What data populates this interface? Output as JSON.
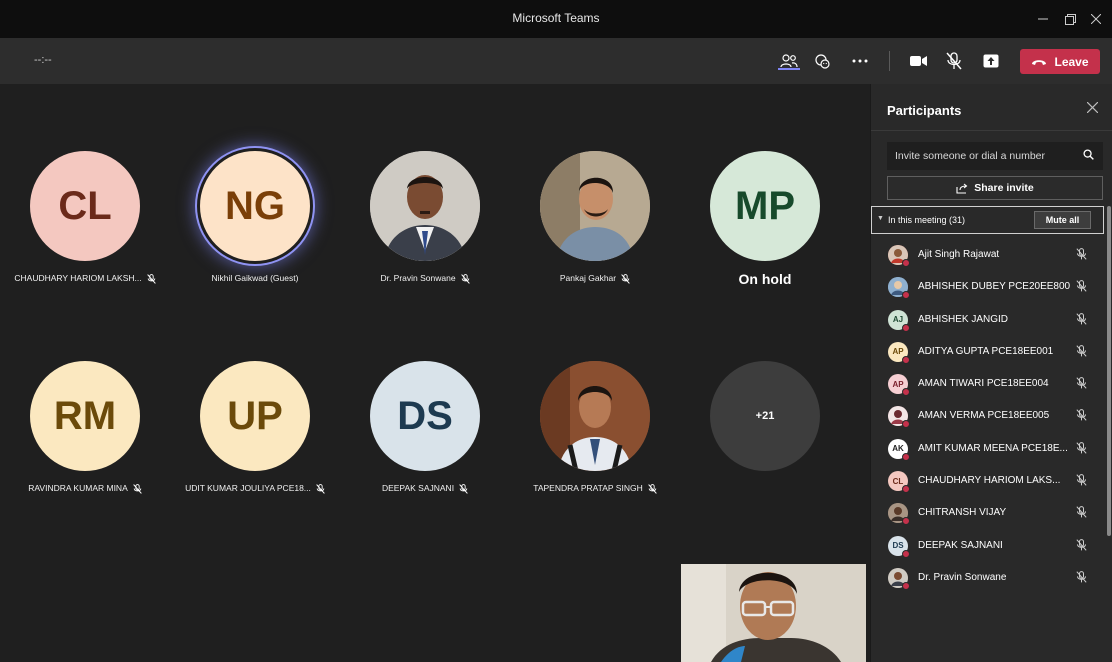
{
  "window": {
    "title": "Microsoft Teams"
  },
  "toolbar": {
    "timer": "--:--",
    "leave_label": "Leave"
  },
  "tiles": [
    {
      "initials": "CL",
      "name": "CHAUDHARY HARIOM LAKSH...",
      "bg": "#f4c8c0",
      "fg": "#6b2a1a",
      "muted": true
    },
    {
      "initials": "NG",
      "name": "Nikhil Gaikwad (Guest)",
      "bg": "#fde3c8",
      "fg": "#6b3a0a",
      "muted": false,
      "speaking": true
    },
    {
      "initials": "",
      "name": "Dr. Pravin Sonwane",
      "photo": true,
      "muted": true
    },
    {
      "initials": "",
      "name": "Pankaj Gakhar",
      "photo": true,
      "muted": true
    },
    {
      "initials": "MP",
      "name": "On hold",
      "bg": "#d6e8d8",
      "fg": "#174a2b",
      "muted": false,
      "onhold": true
    },
    {
      "initials": "RM",
      "name": "RAVINDRA KUMAR MINA",
      "bg": "#fbe8c0",
      "fg": "#6b4a0a",
      "muted": true
    },
    {
      "initials": "UP",
      "name": "UDIT KUMAR JOULIYA PCE18...",
      "bg": "#fbe8c0",
      "fg": "#6b4a0a",
      "muted": true
    },
    {
      "initials": "DS",
      "name": "DEEPAK SAJNANI",
      "bg": "#d9e3ea",
      "fg": "#1d3a50",
      "muted": true
    },
    {
      "initials": "",
      "name": "TAPENDRA PRATAP SINGH",
      "photo": true,
      "muted": true
    },
    {
      "initials": "+21",
      "name": "",
      "bg": "#3d3d3d",
      "fg": "#ffffff",
      "overflow": true
    }
  ],
  "panel": {
    "title": "Participants",
    "invite_placeholder": "Invite someone or dial a number",
    "share_label": "Share invite",
    "section_label": "In this meeting (31)",
    "mute_all_label": "Mute all",
    "participants": [
      {
        "name": "Ajit Singh Rajawat",
        "initials": "",
        "photo": true,
        "bg": "#b9473a"
      },
      {
        "name": "ABHISHEK DUBEY PCE20EE800",
        "initials": "",
        "photo": true,
        "bg": "#6f8fae"
      },
      {
        "name": "ABHISHEK JANGID",
        "initials": "AJ",
        "bg": "#cfe3d5",
        "fg": "#1f4a33"
      },
      {
        "name": "ADITYA GUPTA PCE18EE001",
        "initials": "AP",
        "bg": "#fbe8c0",
        "fg": "#6b4a0a"
      },
      {
        "name": "AMAN TIWARI PCE18EE004",
        "initials": "AP",
        "bg": "#f6cfd3",
        "fg": "#7a1f2c"
      },
      {
        "name": "AMAN VERMA PCE18EE005",
        "initials": "",
        "photo": true,
        "bg": "#8a3d46"
      },
      {
        "name": "AMIT KUMAR MEENA PCE18E...",
        "initials": "AK",
        "bg": "#ffffff",
        "fg": "#222222"
      },
      {
        "name": "CHAUDHARY HARIOM LAKS...",
        "initials": "CL",
        "bg": "#f4c8c0",
        "fg": "#6b2a1a"
      },
      {
        "name": "CHITRANSH VIJAY",
        "initials": "",
        "photo": true,
        "bg": "#7d6a5c"
      },
      {
        "name": "DEEPAK SAJNANI",
        "initials": "DS",
        "bg": "#d9e3ea",
        "fg": "#1d3a50"
      },
      {
        "name": "Dr. Pravin Sonwane",
        "initials": "",
        "photo": true,
        "bg": "#6a5a4a"
      }
    ]
  }
}
